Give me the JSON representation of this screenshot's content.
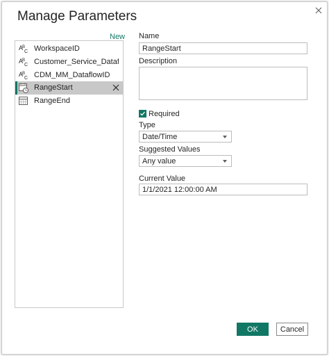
{
  "dialog": {
    "title": "Manage Parameters",
    "new_label": "New"
  },
  "parameters": [
    {
      "label": "WorkspaceID",
      "icon": "abc-text-icon",
      "selected": false
    },
    {
      "label": "Customer_Service_Dataflow...",
      "icon": "abc-text-icon",
      "selected": false
    },
    {
      "label": "CDM_MM_DataflowID",
      "icon": "abc-text-icon",
      "selected": false
    },
    {
      "label": "RangeStart",
      "icon": "calendar-clock-icon",
      "selected": true
    },
    {
      "label": "RangeEnd",
      "icon": "calendar-icon",
      "selected": false
    }
  ],
  "form": {
    "name_label": "Name",
    "name_value": "RangeStart",
    "description_label": "Description",
    "description_value": "",
    "required_label": "Required",
    "required_checked": true,
    "type_label": "Type",
    "type_value": "Date/Time",
    "suggested_label": "Suggested Values",
    "suggested_value": "Any value",
    "current_label": "Current Value",
    "current_value": "1/1/2021 12:00:00 AM"
  },
  "buttons": {
    "ok_label": "OK",
    "cancel_label": "Cancel"
  },
  "colors": {
    "accent": "#117865",
    "selected_bg": "#c8c8c8"
  }
}
